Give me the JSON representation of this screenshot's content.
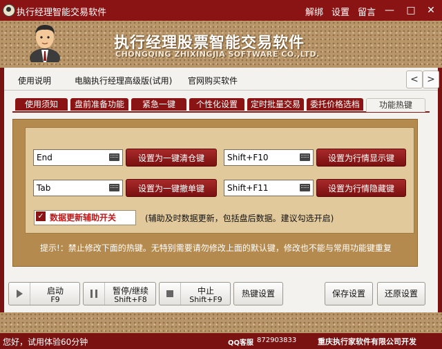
{
  "window": {
    "title": "执行经理智能交易软件",
    "links": [
      "解绑",
      "设置",
      "留言"
    ],
    "minimize": "—",
    "maximize": "□",
    "close": "✕"
  },
  "banner": {
    "title": "执行经理股票智能交易软件",
    "subtitle": "CHONGQING ZHIXINGJIA SOFTWARE CO.,LTD."
  },
  "nav": {
    "items": [
      "使用说明",
      "电脑执行经理高级版(试用)",
      "官网购买软件"
    ],
    "prev": "<",
    "next": ">"
  },
  "subtabs": [
    {
      "label": "使用须知"
    },
    {
      "label": "盘前准备功能"
    },
    {
      "label": "紧急一键"
    },
    {
      "label": "个性化设置"
    },
    {
      "label": "定时批量交易"
    },
    {
      "label": "委托价格选档"
    },
    {
      "label": "功能热键",
      "active": true
    }
  ],
  "hotkeys": [
    {
      "key": "End",
      "button": "设置为一键清仓键"
    },
    {
      "key": "Shift+F10",
      "button": "设置为行情显示键"
    },
    {
      "key": "Tab",
      "button": "设置为一键撤单键"
    },
    {
      "key": "Shift+F11",
      "button": "设置为行情隐藏键"
    }
  ],
  "assist": {
    "checked": true,
    "check_mark": "✓",
    "label": "数据更新辅助开关",
    "hint": "(辅助及时数据更新，包括盘后数据。建议勾选开启)"
  },
  "tip": "提示!：禁止修改下面的热键。无特别需要请勿修改上面的默认键，修改也不能与常用功能键重复",
  "controls": {
    "start": {
      "label": "启动",
      "key": "F9"
    },
    "pause": {
      "label": "暂停/继续",
      "key": "Shift+F8"
    },
    "stop": {
      "label": "中止",
      "key": "Shift+F9"
    },
    "hotkey_settings": "热键设置",
    "save_settings": "保存设置",
    "restore_settings": "还原设置"
  },
  "status": {
    "trial": "您好，试用体验60分钟",
    "qq_label": "QQ客服",
    "qq_number": "872903833",
    "company": "重庆执行家软件有限公司开发"
  }
}
